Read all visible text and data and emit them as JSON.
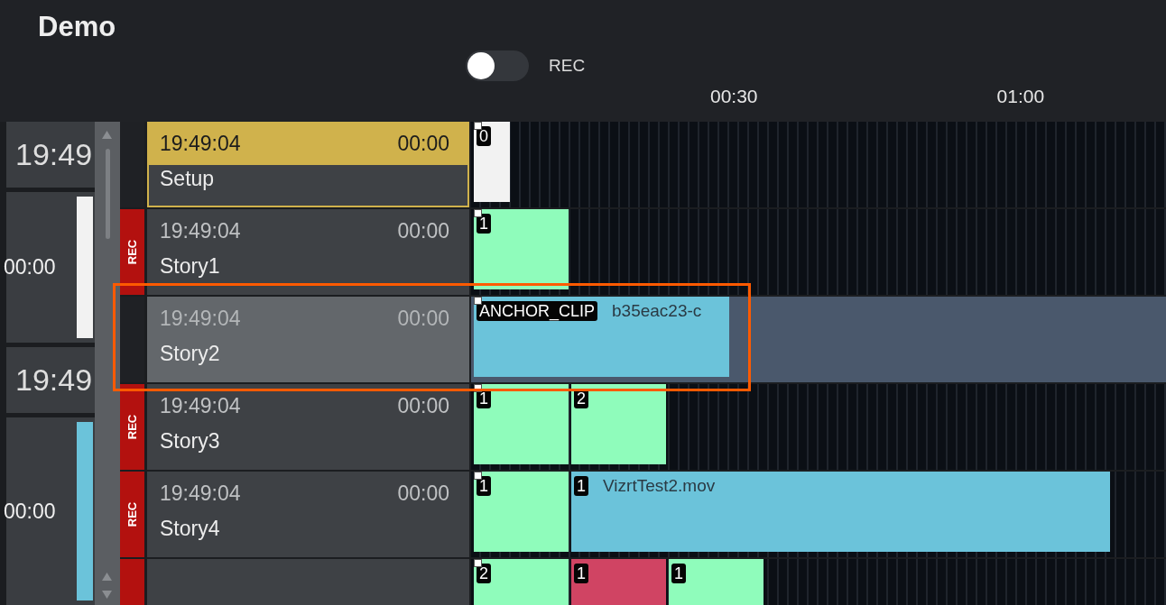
{
  "window": {
    "title": "Demo"
  },
  "rec_toggle": {
    "label": "REC",
    "on": false
  },
  "ruler": {
    "labels": [
      "00:30",
      "01:00"
    ]
  },
  "side_panel": [
    {
      "kind": "clock",
      "text": "19:49"
    },
    {
      "kind": "duration",
      "text": "00:00",
      "color": "#f2f2f2"
    },
    {
      "kind": "clock",
      "text": "19:49"
    },
    {
      "kind": "duration",
      "text": "00:00",
      "color": "#6bc3da"
    }
  ],
  "rows": [
    {
      "time": "19:49:04",
      "duration": "00:00",
      "name": "Setup",
      "rec": false,
      "selected": true,
      "focused": false,
      "clips": [
        {
          "kind": "marker",
          "badge": "0",
          "color": "#f2f2f2"
        }
      ]
    },
    {
      "rec_label": "REC",
      "time": "19:49:04",
      "duration": "00:00",
      "name": "Story1",
      "rec": true,
      "selected": false,
      "focused": false,
      "clips": [
        {
          "kind": "graphic",
          "badge": "1",
          "color": "#8ffcbb"
        }
      ]
    },
    {
      "time": "19:49:04",
      "duration": "00:00",
      "name": "Story2",
      "rec": false,
      "selected": false,
      "focused": true,
      "clips": [
        {
          "kind": "anchor",
          "badge": "ANCHOR_CLIP",
          "label": "b35eac23-c",
          "color": "#6bc3da"
        }
      ]
    },
    {
      "rec_label": "REC",
      "time": "19:49:04",
      "duration": "00:00",
      "name": "Story3",
      "rec": true,
      "selected": false,
      "focused": false,
      "clips": [
        {
          "kind": "graphic",
          "badge": "1",
          "color": "#8ffcbb"
        },
        {
          "kind": "graphic",
          "badge": "2",
          "color": "#8ffcbb"
        }
      ]
    },
    {
      "rec_label": "REC",
      "time": "19:49:04",
      "duration": "00:00",
      "name": "Story4",
      "rec": true,
      "selected": false,
      "focused": false,
      "clips": [
        {
          "kind": "graphic",
          "badge": "1",
          "color": "#8ffcbb"
        },
        {
          "kind": "video",
          "badge": "1",
          "label": "VizrtTest2.mov",
          "color": "#6bc3da"
        }
      ]
    },
    {
      "rec": true,
      "selected": false,
      "focused": false,
      "clips": [
        {
          "kind": "graphic",
          "badge": "2",
          "color": "#8ffcbb"
        },
        {
          "kind": "graphic",
          "badge": "1",
          "color": "#d04463"
        },
        {
          "kind": "graphic",
          "badge": "1",
          "color": "#8ffcbb"
        }
      ]
    }
  ],
  "highlight": true
}
